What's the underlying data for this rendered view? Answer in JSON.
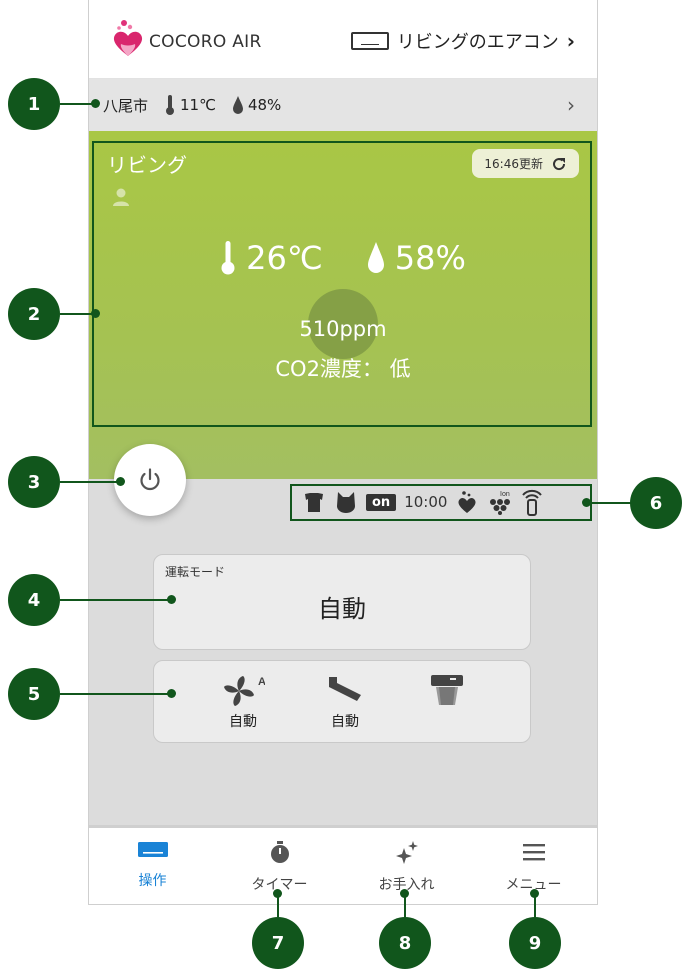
{
  "header": {
    "brand": "COCORO AIR",
    "device": "リビングのエアコン"
  },
  "weather": {
    "city": "八尾市",
    "temperature": "11℃",
    "humidity": "48%"
  },
  "status": {
    "room": "リビング",
    "update_label": "16:46更新",
    "temperature": "26℃",
    "humidity": "58%",
    "co2_value": "510ppm",
    "co2_level": "CO2濃度： 低"
  },
  "indicators": {
    "on_label": "on",
    "timer_time": "10:00",
    "ion_label": "Ion"
  },
  "operation": {
    "mode_label": "運転モード",
    "mode_value": "自動"
  },
  "airflow": {
    "fan_label": "自動",
    "fan_badge": "A",
    "direction_label": "自動"
  },
  "nav": {
    "items": [
      {
        "label": "操作",
        "active": true
      },
      {
        "label": "タイマー",
        "active": false
      },
      {
        "label": "お手入れ",
        "active": false
      },
      {
        "label": "メニュー",
        "active": false
      }
    ]
  },
  "callouts": [
    "1",
    "2",
    "3",
    "4",
    "5",
    "6",
    "7",
    "8",
    "9"
  ],
  "colors": {
    "accent_blue": "#1a83d6",
    "status_green": "#a9c745",
    "callout_green": "#11561c",
    "brand_pink": "#e0337a"
  }
}
